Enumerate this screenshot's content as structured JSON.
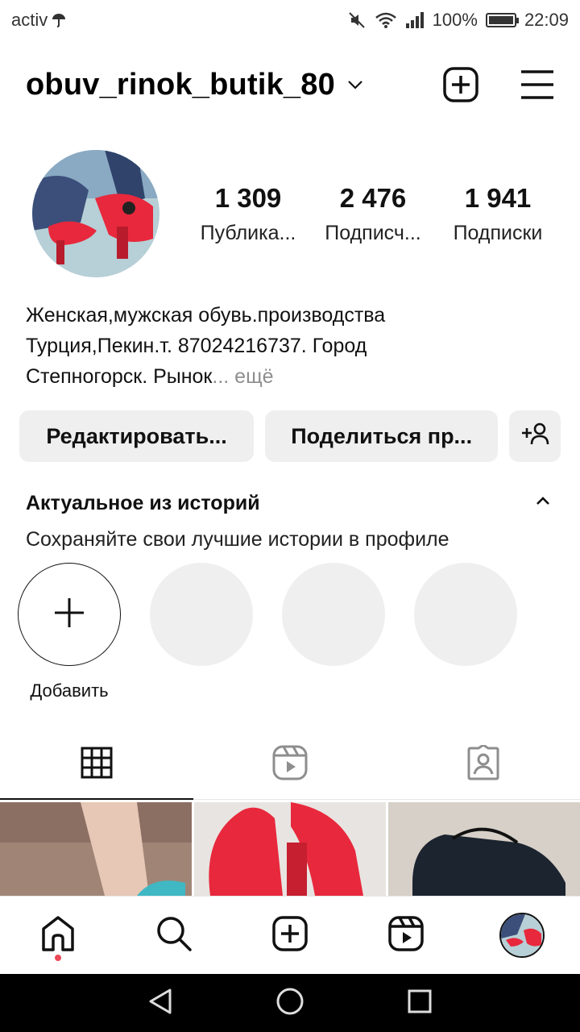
{
  "status_bar": {
    "carrier": "activ",
    "battery_text": "100%",
    "battery_level": 1.0,
    "time": "22:09"
  },
  "header": {
    "username": "obuv_rinok_butik_80"
  },
  "stats": [
    {
      "value": "1 309",
      "label": "Публика..."
    },
    {
      "value": "2 476",
      "label": "Подписч..."
    },
    {
      "value": "1 941",
      "label": "Подписки"
    }
  ],
  "bio": {
    "line1": "Женская,мужская обувь.производства",
    "line2": "Турция,Пекин.т. 87024216737.  Город",
    "line3": "Степногорск.  Рынок",
    "ellipsis": "...",
    "more": "ещё"
  },
  "buttons": {
    "edit": "Редактировать...",
    "share": "Поделиться пр..."
  },
  "highlights": {
    "title": "Актуальное из историй",
    "subtitle": "Сохраняйте свои лучшие истории в профиле",
    "add_label": "Добавить"
  },
  "icons": {
    "header": [
      "chevron-down-icon",
      "new-post-icon",
      "menu-icon"
    ],
    "tabs": [
      "grid-icon",
      "reels-icon",
      "tagged-icon"
    ],
    "nav": [
      "home-icon",
      "search-icon",
      "create-icon",
      "reels-icon",
      "profile-avatar"
    ]
  },
  "colors": {
    "button_bg": "#efefef",
    "notification_dot": "#ed4956",
    "shoe_red": "#e8283c"
  }
}
